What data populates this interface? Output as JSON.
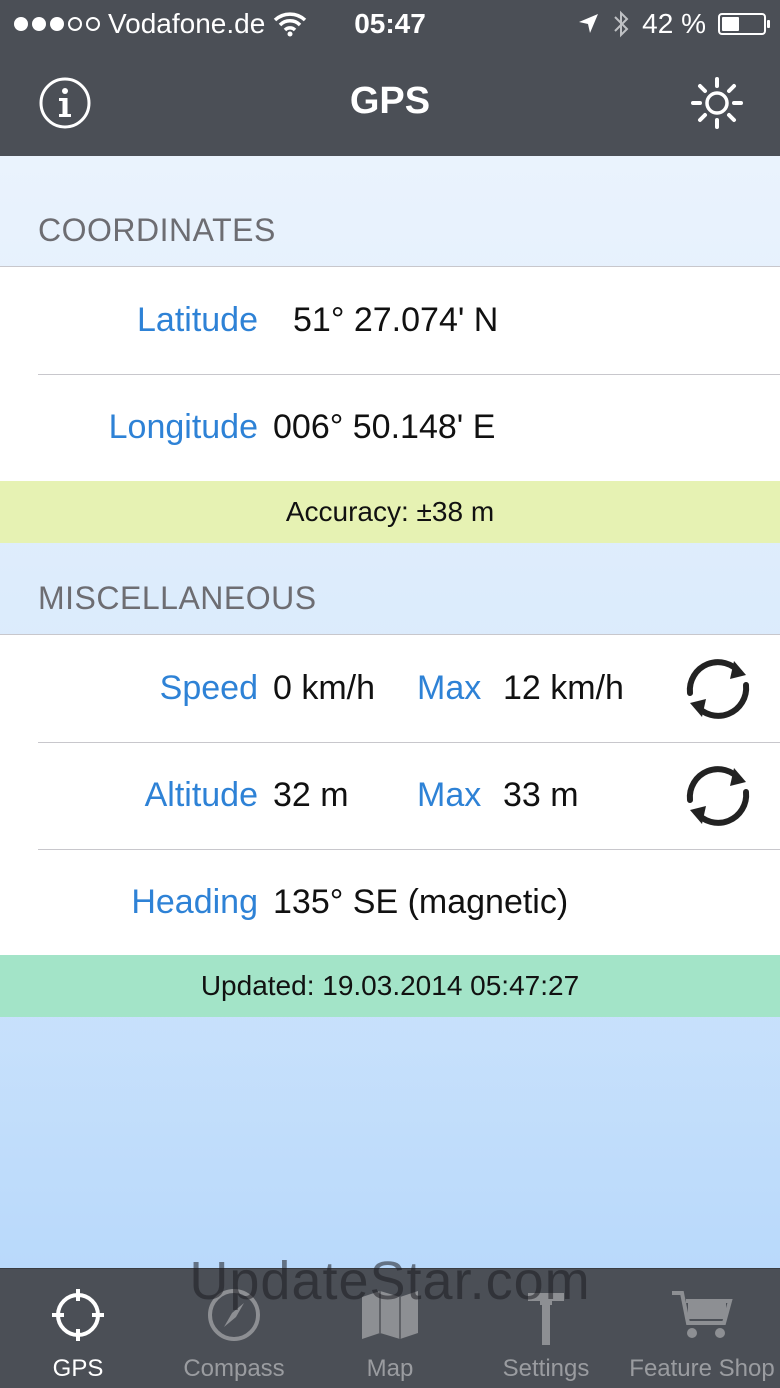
{
  "status_bar": {
    "carrier": "Vodafone.de",
    "time": "05:47",
    "battery": "42 %",
    "battery_level": 0.42,
    "signal_bars": 3,
    "signal_total": 5
  },
  "nav": {
    "title": "GPS",
    "info_icon": "info-icon",
    "settings_icon": "sun-icon"
  },
  "coordinates": {
    "header": "COORDINATES",
    "latitude_label": "Latitude",
    "latitude_value": "51° 27.074' N",
    "longitude_label": "Longitude",
    "longitude_value": "006° 50.148' E",
    "accuracy": "Accuracy: ±38 m"
  },
  "misc": {
    "header": "MISCELLANEOUS",
    "speed_label": "Speed",
    "speed_value": "0 km/h",
    "speed_max_label": "Max",
    "speed_max_value": "12 km/h",
    "altitude_label": "Altitude",
    "altitude_value": "32 m",
    "altitude_max_label": "Max",
    "altitude_max_value": "33 m",
    "heading_label": "Heading",
    "heading_value": "135° SE (magnetic)",
    "updated": "Updated: 19.03.2014 05:47:27"
  },
  "tabs": [
    {
      "label": "GPS",
      "icon": "crosshair-icon",
      "active": true
    },
    {
      "label": "Compass",
      "icon": "compass-icon",
      "active": false
    },
    {
      "label": "Map",
      "icon": "map-icon",
      "active": false
    },
    {
      "label": "Settings",
      "icon": "hammer-icon",
      "active": false
    },
    {
      "label": "Feature Shop",
      "icon": "cart-icon",
      "active": false
    }
  ],
  "watermark": "UpdateStar.com",
  "colors": {
    "bar": "#4b4f56",
    "label_blue": "#2e82d6",
    "accuracy_band": "#e6f2b3",
    "updated_band": "#a3e4c8"
  }
}
